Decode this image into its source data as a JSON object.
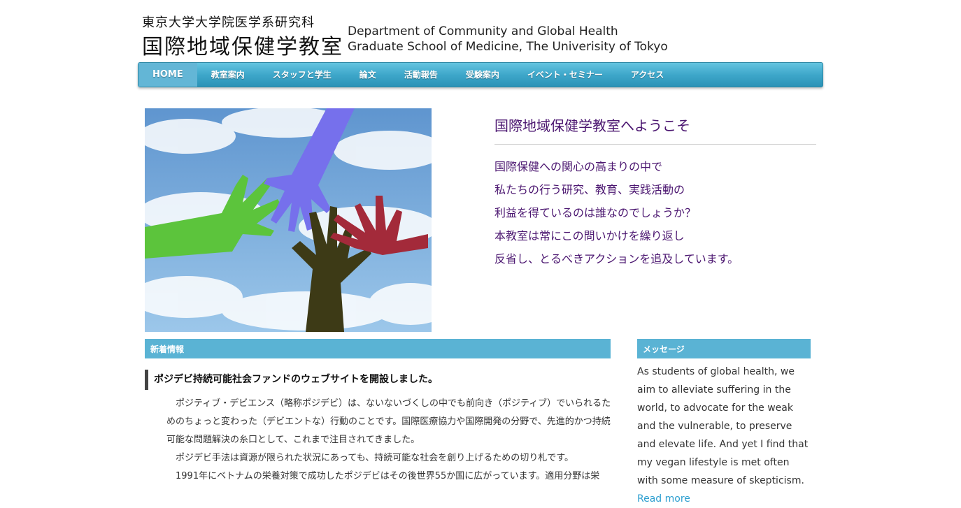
{
  "header": {
    "university": "東京大学大学院医学系研究科",
    "department": "国際地域保健学教室",
    "english_line1": "Department of Community and Global Health",
    "english_line2": "Graduate School of Medicine, The Univerisity of Tokyo"
  },
  "nav": {
    "items": [
      "HOME",
      "教室案内",
      "スタッフと学生",
      "論文",
      "活動報告",
      "受験案内",
      "イベント・セミナー",
      "アクセス"
    ],
    "active": "HOME"
  },
  "welcome": {
    "title": "国際地域保健学教室へようこそ",
    "lines": [
      "国際保健への関心の高まりの中で",
      "私たちの行う研究、教育、実践活動の",
      "利益を得ているのは誰なのでしょうか？",
      "本教室は常にこの問いかけを繰り返し",
      "反省し、とるべきアクションを追及しています。"
    ]
  },
  "news": {
    "header": "新着情報",
    "title": "ポジデビ持続可能社会ファンドのウェブサイトを開設しました。",
    "paragraphs": [
      "　ポジティブ・デビエンス（略称ポジデビ）は、ないないづくしの中でも前向き（ポジティブ）でいられるためのちょっと変わった（デビエントな）行動のことです。国際医療協力や国際開発の分野で、先進的かつ持続可能な問題解決の糸口として、これまで注目されてきました。",
      "　ポジデビ手法は資源が限られた状況にあっても、持続可能な社会を創り上げるための切り札です。",
      "　1991年にベトナムの栄養対策で成功したポジデビはその後世界55か国に広がっています。適用分野は栄"
    ]
  },
  "message": {
    "header": "メッセージ",
    "body": "As students of global health, we aim to alleviate suffering in the world, to advocate for the weak and the vulnerable, to preserve and elevate life. And yet I find that my vegan lifestyle is met often with some measure of skepticism.",
    "read_more": "Read more"
  },
  "colors": {
    "nav_gradient": "#3ea7ca",
    "section_header": "#5ab3d4",
    "welcome_text": "#4b1670",
    "link": "#2d9fd0"
  }
}
